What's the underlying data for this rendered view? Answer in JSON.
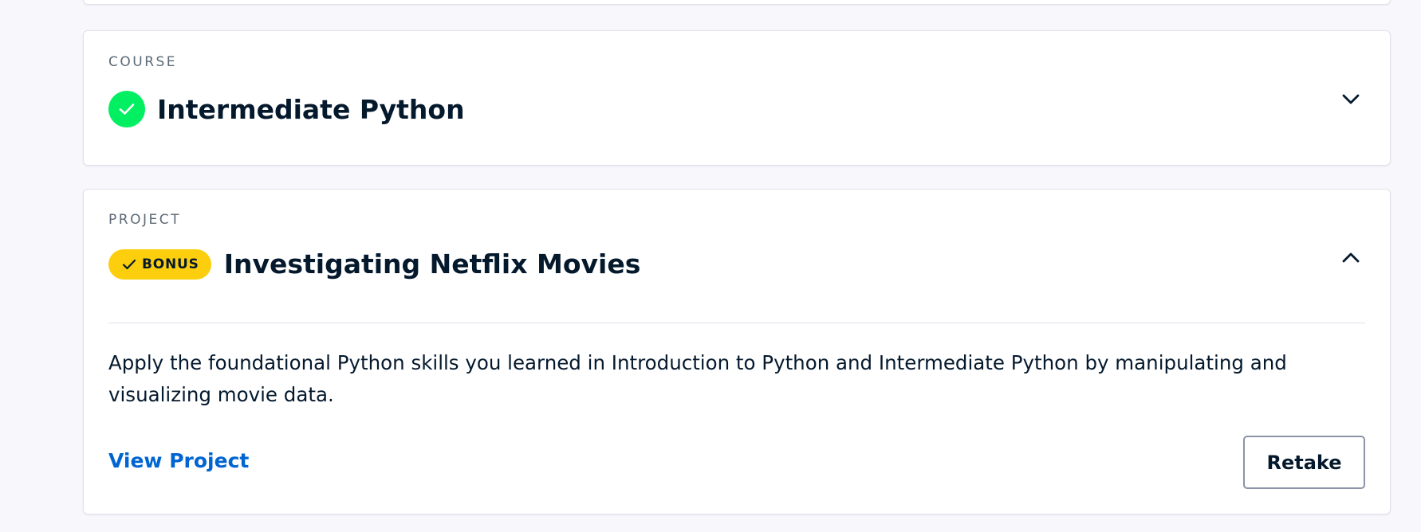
{
  "course": {
    "type_label": "COURSE",
    "title": "Intermediate Python",
    "status_icon": "check-circle-icon",
    "expand_icon": "chevron-down-icon"
  },
  "project": {
    "type_label": "PROJECT",
    "badge_label": "BONUS",
    "badge_icon": "check-icon",
    "title": "Investigating Netflix Movies",
    "collapse_icon": "chevron-up-icon",
    "description": "Apply the foundational Python skills you learned in Introduction to Python and Intermediate Python by manipulating and visualizing movie data.",
    "view_link_label": "View Project",
    "retake_label": "Retake"
  },
  "colors": {
    "background": "#f7f7fc",
    "success_green": "#03ef62",
    "badge_yellow": "#fcce0d",
    "link_blue": "#0065d1",
    "text_navy": "#05192d"
  }
}
